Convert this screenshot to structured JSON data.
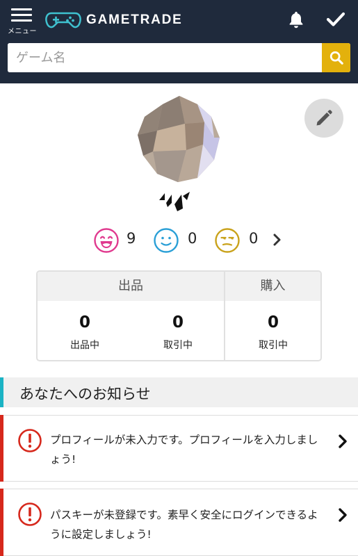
{
  "header": {
    "menu_label": "メニュー",
    "menu_icon": "hamburger-icon",
    "logo_text": "GAMETRADE",
    "logo_icon": "gamepad-icon",
    "bell_icon": "bell-icon",
    "check_icon": "checkmark-icon",
    "bg_color": "#1f2a3c",
    "accent_color": "#3fc1cf"
  },
  "search": {
    "placeholder": "ゲーム名",
    "value": "",
    "button_icon": "search-icon",
    "button_color": "#e3b10c"
  },
  "profile": {
    "edit_icon": "pencil-icon",
    "ratings": [
      {
        "icon": "happy-face-icon",
        "count": "9",
        "color": "#e0398e"
      },
      {
        "icon": "neutral-face-icon",
        "count": "0",
        "color": "#2a9fd6"
      },
      {
        "icon": "unhappy-face-icon",
        "count": "0",
        "color": "#c9a21b"
      }
    ],
    "ratings_more_icon": "chevron-right-icon"
  },
  "stats": {
    "listing_header": "出品",
    "purchase_header": "購入",
    "listing_active_value": "0",
    "listing_active_label": "出品中",
    "listing_trading_value": "0",
    "listing_trading_label": "取引中",
    "purchase_trading_value": "0",
    "purchase_trading_label": "取引中"
  },
  "notices": {
    "title": "あなたへのお知らせ",
    "title_accent": "#1bb3c4",
    "alert_color": "#d6281c",
    "items": [
      {
        "line1": "プロフィールが未入力です。プロフィールを入力しまし",
        "line2": "ょう!",
        "icon": "alert-circle-icon"
      },
      {
        "line1": "パスキーが未登録です。素早く安全にログインできるよ",
        "line2": "うに設定しましょう!",
        "icon": "alert-circle-icon"
      }
    ]
  }
}
